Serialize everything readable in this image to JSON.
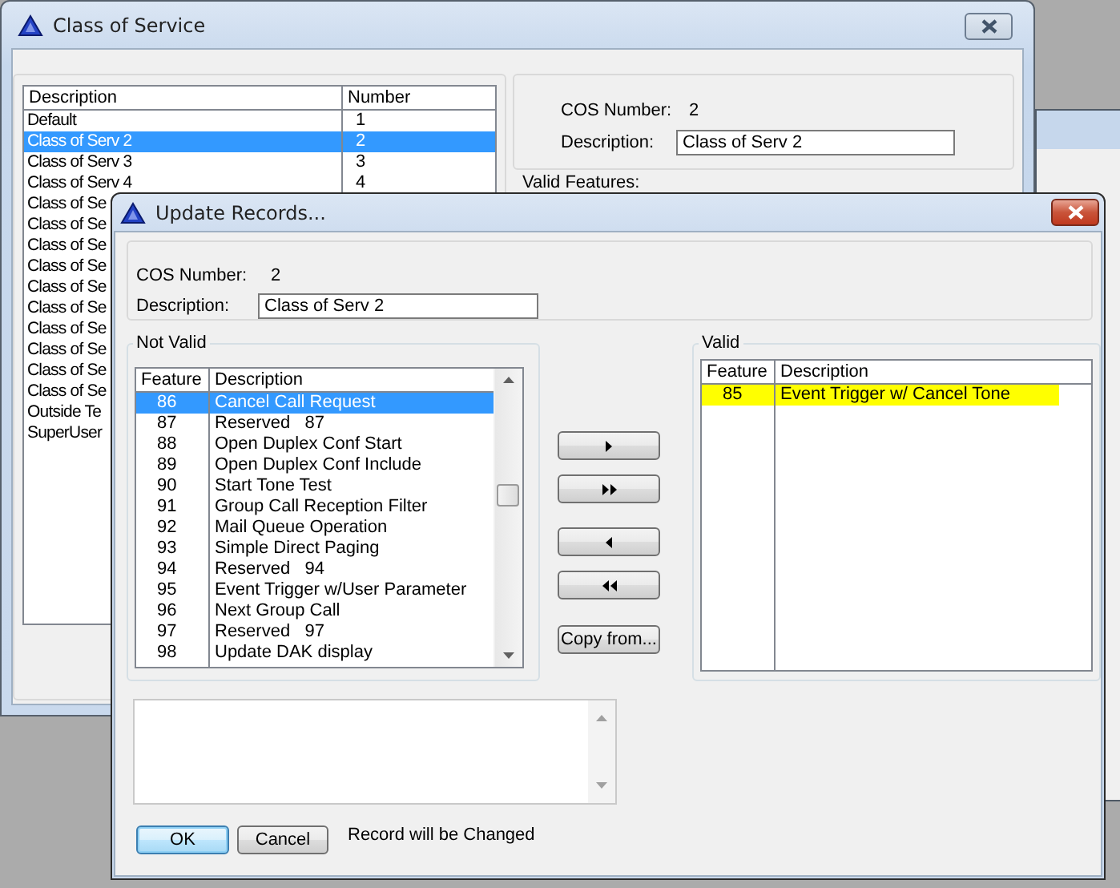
{
  "back_window": {
    "title": "Class of Service",
    "list": {
      "columns": [
        "Description",
        "Number"
      ],
      "rows": [
        {
          "description": "Default",
          "number": "1",
          "selected": false
        },
        {
          "description": "Class of Serv 2",
          "number": "2",
          "selected": true
        },
        {
          "description": "Class of Serv 3",
          "number": "3",
          "selected": false
        },
        {
          "description": "Class of Serv 4",
          "number": "4",
          "selected": false
        },
        {
          "description": "Class of Se",
          "selected": false
        },
        {
          "description": "Class of Se",
          "selected": false
        },
        {
          "description": "Class of Se",
          "selected": false
        },
        {
          "description": "Class of Se",
          "selected": false
        },
        {
          "description": "Class of Se",
          "selected": false
        },
        {
          "description": "Class of Se",
          "selected": false
        },
        {
          "description": "Class of Se",
          "selected": false
        },
        {
          "description": "Class of Se",
          "selected": false
        },
        {
          "description": "Class of Se",
          "selected": false
        },
        {
          "description": "Class of Se",
          "selected": false
        },
        {
          "description": "Outside Te",
          "selected": false
        },
        {
          "description": "SuperUser",
          "selected": false
        }
      ]
    },
    "details": {
      "cos_number_label": "COS Number:",
      "cos_number": "2",
      "description_label": "Description:",
      "description_value": "Class of Serv 2"
    },
    "valid_features_label": "Valid Features:"
  },
  "dialog": {
    "title": "Update Records...",
    "cos_number_label": "COS Number:",
    "cos_number": "2",
    "description_label": "Description:",
    "description_value": "Class of Serv 2",
    "not_valid": {
      "title": "Not Valid",
      "columns": [
        "Feature",
        "Description"
      ],
      "rows": [
        {
          "feature": "86",
          "description": "Cancel Call Request",
          "selected": true
        },
        {
          "feature": "87",
          "description": "Reserved   87",
          "selected": false
        },
        {
          "feature": "88",
          "description": "Open Duplex Conf Start",
          "selected": false
        },
        {
          "feature": "89",
          "description": "Open Duplex Conf Include",
          "selected": false
        },
        {
          "feature": "90",
          "description": "Start Tone Test",
          "selected": false
        },
        {
          "feature": "91",
          "description": "Group Call Reception Filter",
          "selected": false
        },
        {
          "feature": "92",
          "description": "Mail Queue Operation",
          "selected": false
        },
        {
          "feature": "93",
          "description": "Simple Direct Paging",
          "selected": false
        },
        {
          "feature": "94",
          "description": "Reserved   94",
          "selected": false
        },
        {
          "feature": "95",
          "description": "Event Trigger w/User Parameter",
          "selected": false
        },
        {
          "feature": "96",
          "description": "Next Group Call",
          "selected": false
        },
        {
          "feature": "97",
          "description": "Reserved   97",
          "selected": false
        },
        {
          "feature": "98",
          "description": "Update DAK display",
          "selected": false
        }
      ]
    },
    "move_buttons": [
      {
        "kind": "add_one"
      },
      {
        "kind": "add_all"
      },
      {
        "kind": "remove_one"
      },
      {
        "kind": "remove_all"
      }
    ],
    "copy_button": "Copy from...",
    "valid": {
      "title": "Valid",
      "columns": [
        "Feature",
        "Description"
      ],
      "rows": [
        {
          "feature": "85",
          "description": "Event Trigger w/ Cancel Tone",
          "selected": false,
          "highlighted": true
        }
      ]
    },
    "buttons": [
      {
        "label": "OK",
        "default": true
      },
      {
        "label": "Cancel",
        "default": false
      }
    ],
    "status": "Record will be Changed"
  }
}
